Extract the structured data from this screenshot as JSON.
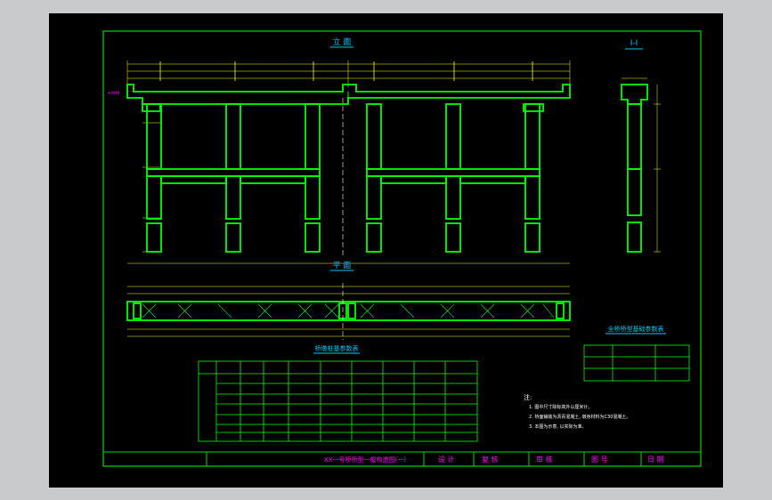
{
  "drawing": {
    "elevation_title": "立 面",
    "section_title": "I-I",
    "plan_title": "平 面",
    "pier_table_title": "桥墩桩基参数表",
    "bearing_table_title": "全桥桥型基础参数表",
    "notes_heading": "注:",
    "notes": [
      "1. 图中尺寸除标高外以厘米计。",
      "2. 桥面铺装为沥青混凝土, 墩身材料为C30混凝土。",
      "3. 本图为示意, 以实际为准。"
    ],
    "title_block": {
      "drawing_name": "XX一号桥桥型一般构造图(一)",
      "design_label": "设 计",
      "review_label": "复 核",
      "approve_label": "审 核",
      "drawing_no_label": "图 号",
      "date_label": "日 期"
    }
  },
  "colors": {
    "viewport_bg": "#000000",
    "page_bg": "#c9cacc",
    "structure": "#00ff00",
    "dimension": "#ffff00",
    "frame": "#00dd00",
    "title": "#00c8ff",
    "annotation": "#ff00ff",
    "text": "#ffffff"
  }
}
